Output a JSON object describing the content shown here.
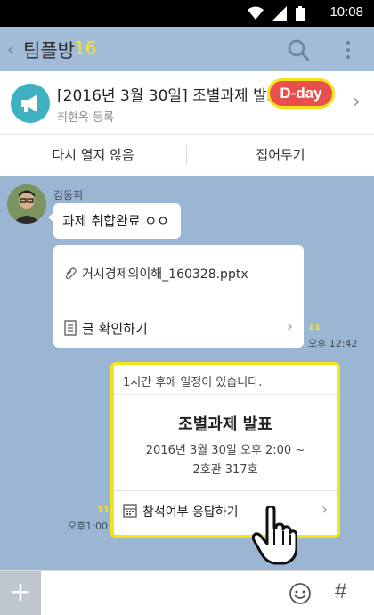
{
  "status_bar": {
    "time": "10:08"
  },
  "header": {
    "room_name": "팀플방",
    "member_count": "16"
  },
  "notice": {
    "title": "[2016년 3월 30일] 조별과제 발표",
    "badge": "D-day",
    "author": "최현옥 등록",
    "actions": [
      "다시 열지 않음",
      "접어두기"
    ]
  },
  "messages": {
    "sender": "김동휘",
    "text": "과제 취합완료 ㅇㅇ",
    "file": {
      "name": "거시경제의이해_160328.pptx",
      "action": "글 확인하기",
      "unread": "11",
      "time": "오후 12:42"
    },
    "event": {
      "header": "1시간 후에 일정이 있습니다.",
      "title": "조별과제 발표",
      "when": "2016년 3월 30일 오후 2:00 ~",
      "where": "2호관 317호",
      "action": "참석여부 응답하기",
      "unread": "11",
      "time": "오후1:00"
    }
  },
  "input_bar": {
    "plus": "+",
    "hash": "#"
  },
  "colors": {
    "chat_bg": "#9bb6d2",
    "accent_yellow": "#f4e21a",
    "badge_red": "#e8504d",
    "notice_icon": "#3fb0bf"
  }
}
